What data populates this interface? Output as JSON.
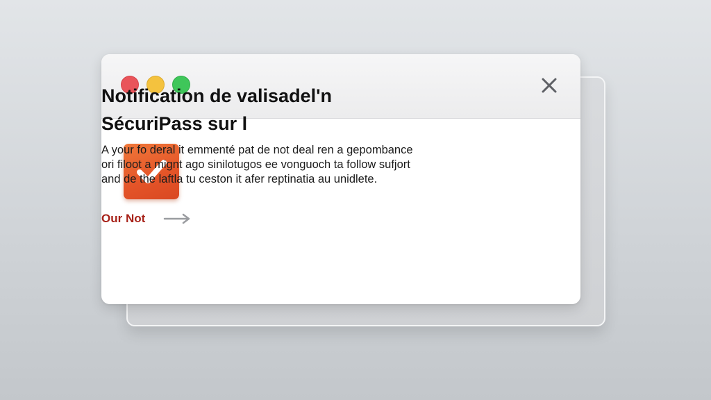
{
  "dialog": {
    "title_line1": "Notification de valisadel'n",
    "title_line2": "SécuriPass sur l",
    "body_lines": [
      "A your fo deral it emmenté pat de not deal ren a gepombance",
      "ori filoot a mignt ago sinilotugos ee vonguoch ta follow sufjort",
      "and de the laftla tu ceston it afer reptinatia au unidlete."
    ],
    "link_label": "Our Not",
    "icons": {
      "status": "checkmark-icon",
      "close": "close-icon",
      "link": "arrow-right-icon"
    }
  },
  "colors": {
    "accent_orange": "#e45428",
    "link_red": "#a8231a",
    "traffic_red": "#e9545a",
    "traffic_yellow": "#f4c23e",
    "traffic_green": "#3fc65a"
  }
}
